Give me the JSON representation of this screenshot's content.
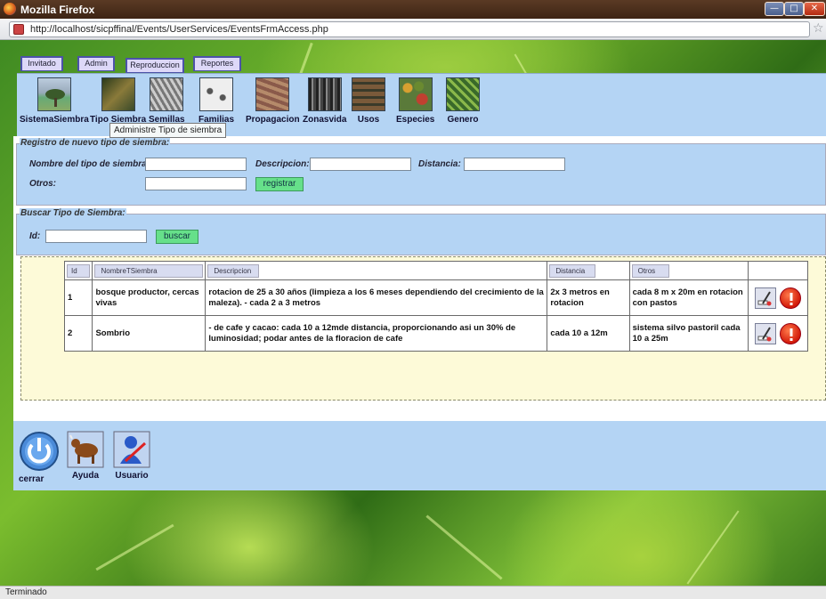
{
  "window": {
    "title": "Mozilla Firefox",
    "url": "http://localhost/sicpffinal/Events/UserServices/EventsFrmAccess.php"
  },
  "tabs": [
    {
      "label": "Invitado"
    },
    {
      "label": "Admin"
    },
    {
      "label": "Reproduccion"
    },
    {
      "label": "Reportes"
    }
  ],
  "menu_items": [
    {
      "label": "SistemaSiembra",
      "icon": "tree-photo-icon"
    },
    {
      "label": "Tipo Siembra",
      "icon": "planting-photo-icon"
    },
    {
      "label": "Semillas",
      "icon": "seeds-photo-icon"
    },
    {
      "label": "Familias",
      "icon": "families-photo-icon"
    },
    {
      "label": "Propagacion",
      "icon": "propagation-photo-icon"
    },
    {
      "label": "Zonasvida",
      "icon": "forest-photo-icon"
    },
    {
      "label": "Usos",
      "icon": "uses-photo-icon"
    },
    {
      "label": "Especies",
      "icon": "species-photo-icon"
    },
    {
      "label": "Genero",
      "icon": "genus-photo-icon"
    }
  ],
  "tooltip": "Administre Tipo de siembra",
  "registro": {
    "legend": "Registro de nuevo tipo de siembra:",
    "nombre_label": "Nombre del tipo de siembra:",
    "descripcion_label": "Descripcion:",
    "distancia_label": "Distancia:",
    "otros_label": "Otros:",
    "nombre_value": "",
    "descripcion_value": "",
    "distancia_value": "",
    "otros_value": "",
    "submit_label": "registrar"
  },
  "buscar": {
    "legend": "Buscar Tipo de Siembra:",
    "id_label": "Id:",
    "id_value": "",
    "submit_label": "buscar"
  },
  "table": {
    "headers": [
      "Id",
      "NombreTSiembra",
      "Descripcion",
      "Distancia",
      "Otros"
    ],
    "rows": [
      {
        "id": "1",
        "nombre": "bosque productor, cercas vivas",
        "descripcion": "rotacion de 25 a 30 años (limpieza a los 6 meses dependiendo del crecimiento de la maleza). - cada 2 a 3 metros",
        "distancia": "2x 3 metros en rotacion",
        "otros": "cada 8 m x 20m en rotacion con pastos"
      },
      {
        "id": "2",
        "nombre": "Sombrio",
        "descripcion": "- de cafe y cacao: cada 10 a 12mde distancia, proporcionando asi un 30% de luminosidad; podar antes de la floracion de cafe",
        "distancia": "cada 10 a 12m",
        "otros": "sistema silvo pastoril cada 10 a 25m"
      }
    ]
  },
  "dock": [
    {
      "label": "cerrar",
      "icon": "power-icon"
    },
    {
      "label": "Ayuda",
      "icon": "cow-icon"
    },
    {
      "label": "Usuario",
      "icon": "user-tools-icon"
    }
  ],
  "status": "Terminado"
}
